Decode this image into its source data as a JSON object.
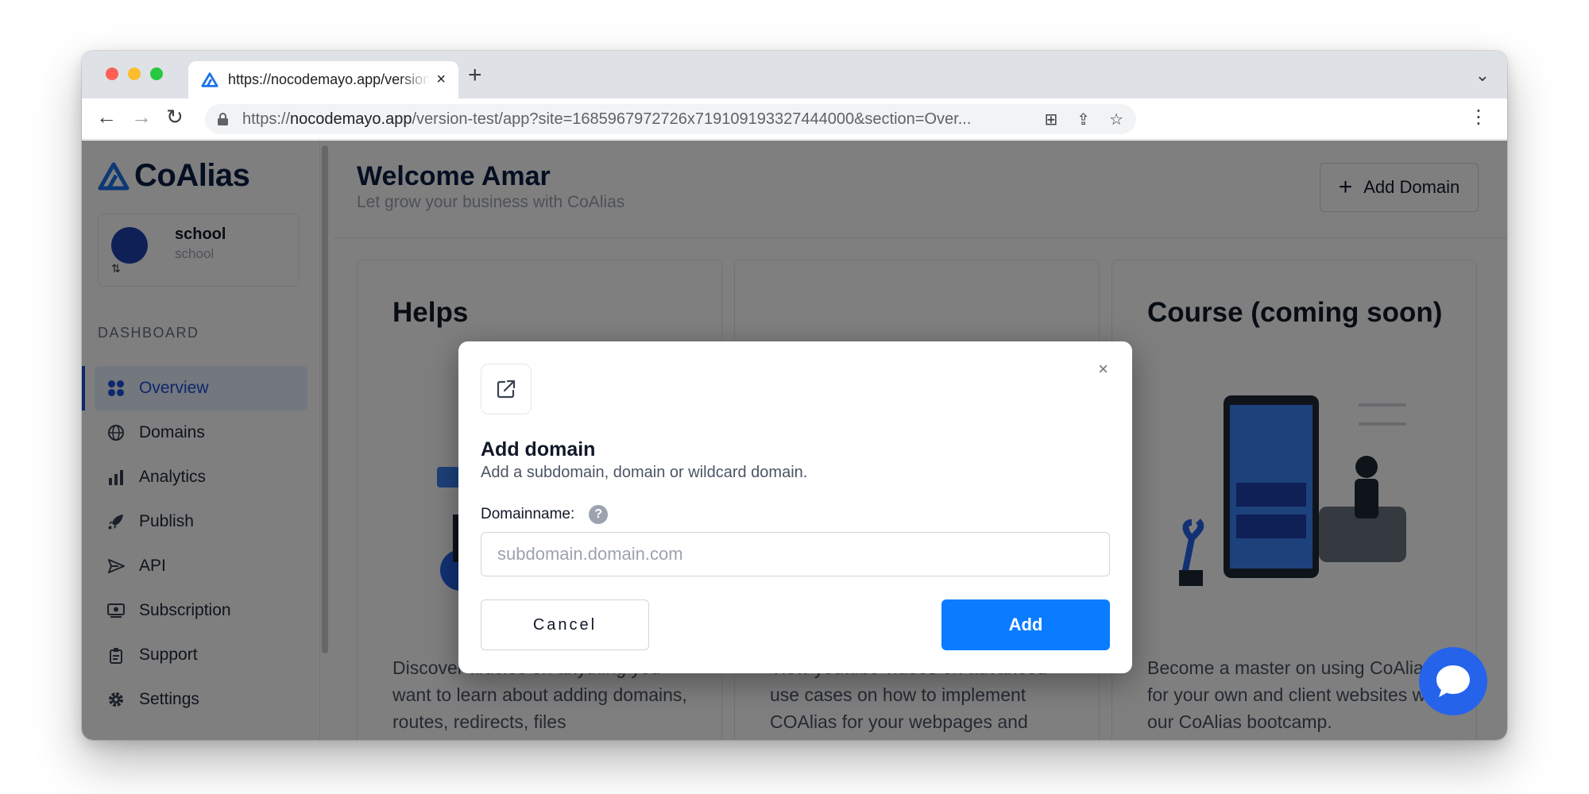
{
  "browser": {
    "tab_title": "https://nocodemayo.app/version-test",
    "tab_close": "×",
    "new_tab": "+",
    "url_prefix": "https://",
    "url_host": "nocodemayo.app",
    "url_path": "/version-test/app?site=1685967972726x719109193327444000&section=Over..."
  },
  "sidebar": {
    "brand": "CoAlias",
    "site_name": "school",
    "site_sub": "school",
    "section_label": "DASHBOARD",
    "items": [
      {
        "label": "Overview",
        "icon": "grid-icon",
        "active": true
      },
      {
        "label": "Domains",
        "icon": "globe-icon",
        "active": false
      },
      {
        "label": "Analytics",
        "icon": "bar-chart-icon",
        "active": false
      },
      {
        "label": "Publish",
        "icon": "rocket-icon",
        "active": false
      },
      {
        "label": "API",
        "icon": "send-icon",
        "active": false
      },
      {
        "label": "Subscription",
        "icon": "billing-icon",
        "active": false
      },
      {
        "label": "Support",
        "icon": "support-icon",
        "active": false
      },
      {
        "label": "Settings",
        "icon": "gear-icon",
        "active": false
      }
    ]
  },
  "header": {
    "title": "Welcome Amar",
    "subtitle": "Let grow your business with CoAlias",
    "add_domain_label": "Add Domain"
  },
  "cards": [
    {
      "title": "Helps",
      "description": "Discover articles on anything you want to learn about adding domains, routes, redirects, files"
    },
    {
      "title": "",
      "description": "View youtube videos on advanced use cases on how to implement COAlias for your webpages and"
    },
    {
      "title": "Course (coming soon)",
      "description": "Become a master on using CoAlias for your own and client websites with our CoAlias bootcamp."
    }
  ],
  "modal": {
    "title": "Add domain",
    "subtitle": "Add a subdomain, domain or wildcard domain.",
    "field_label": "Domainname:",
    "help_glyph": "?",
    "input_placeholder": "subdomain.domain.com",
    "input_value": "",
    "cancel_label": "Cancel",
    "add_label": "Add",
    "close_glyph": "×"
  },
  "colors": {
    "primary": "#0a7cff",
    "brand_navy": "#0b1e44",
    "overlay": "rgba(0,0,0,0.5)"
  }
}
